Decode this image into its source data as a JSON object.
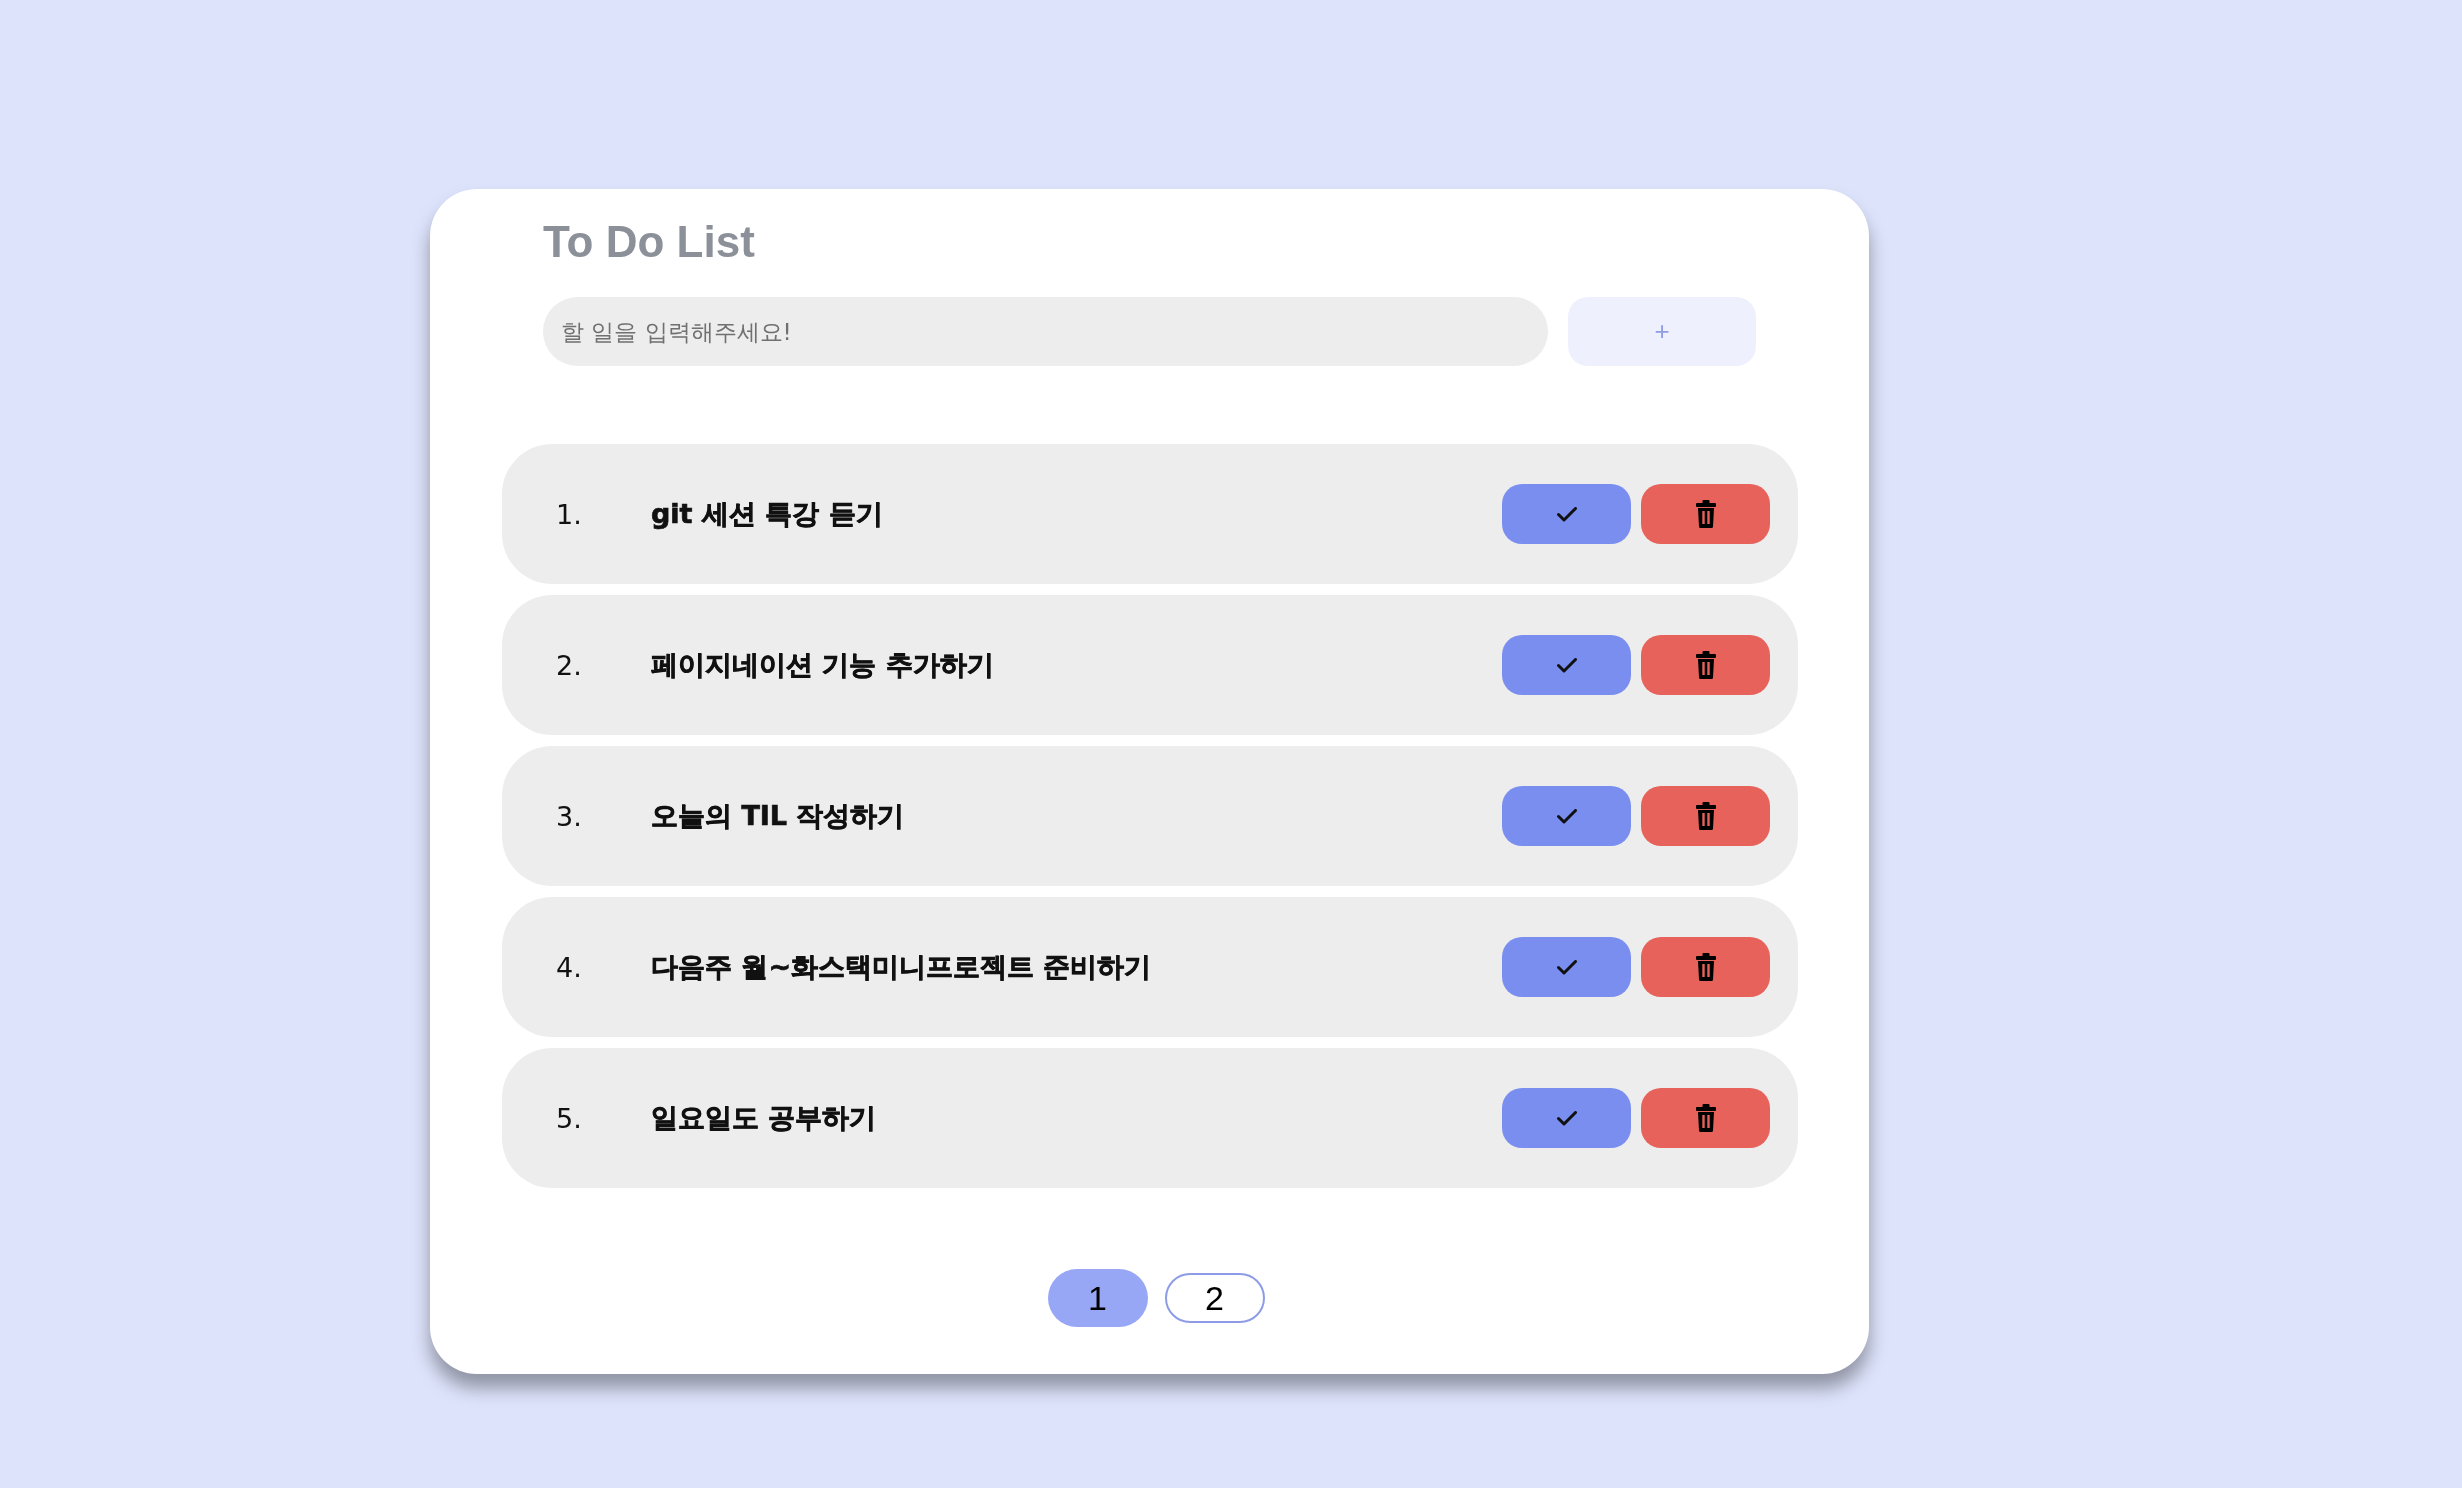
{
  "title": "To Do List",
  "new_task": {
    "placeholder": "할 일을 입력해주세요!"
  },
  "add_button": {
    "label": "+",
    "disabled": true
  },
  "tasks": [
    {
      "number": "1.",
      "text": "git 세션 특강 듣기"
    },
    {
      "number": "2.",
      "text": "페이지네이션 기능 추가하기"
    },
    {
      "number": "3.",
      "text": "오늘의 TIL 작성하기"
    },
    {
      "number": "4.",
      "text": "다음주 월~화스택미니프로젝트 준비하기"
    },
    {
      "number": "5.",
      "text": "일요일도 공부하기"
    }
  ],
  "pagination": [
    {
      "label": "1",
      "selected": true
    },
    {
      "label": "2",
      "selected": false
    }
  ]
}
